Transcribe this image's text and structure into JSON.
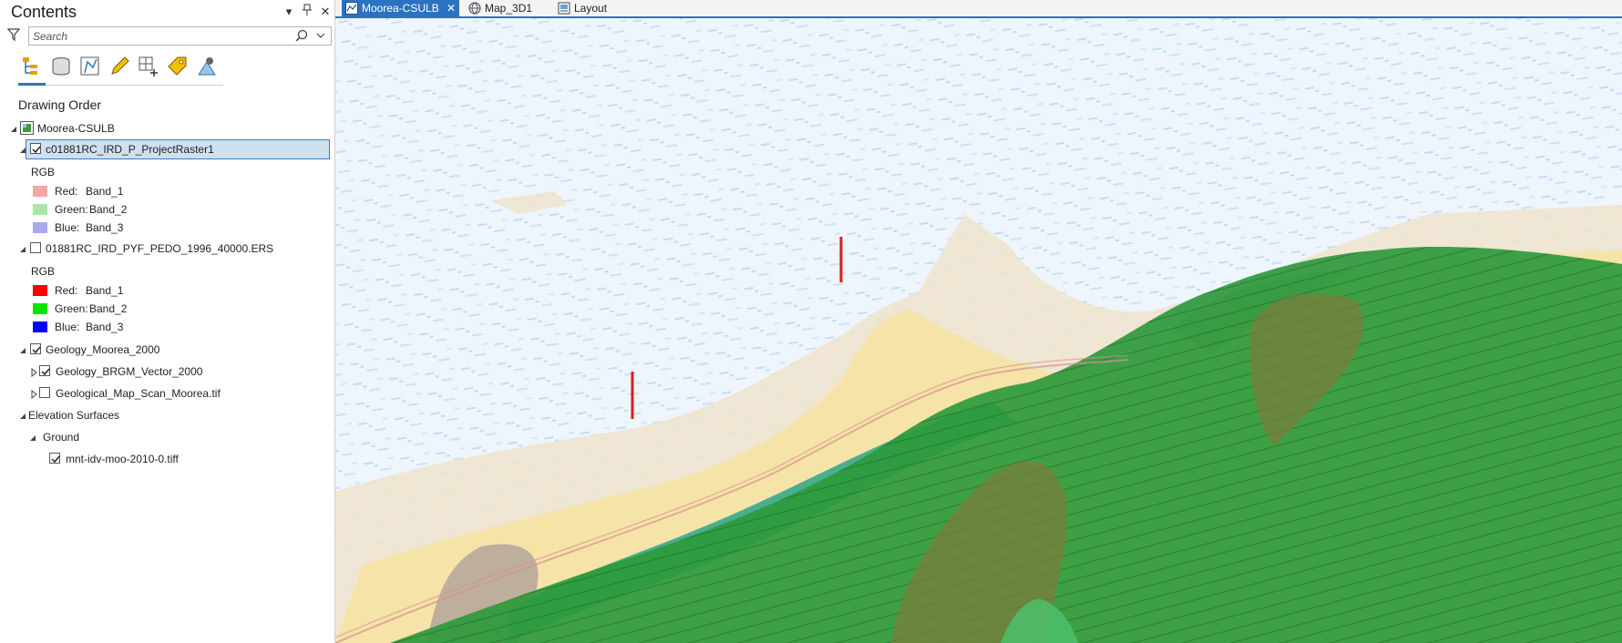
{
  "contents": {
    "title": "Contents",
    "header_buttons": {
      "menu": "▾",
      "pin": "⊿",
      "close": "✕"
    },
    "search": {
      "placeholder": "Search",
      "value": ""
    },
    "section_title": "Drawing Order",
    "map_name": "Moorea-CSULB",
    "layers": [
      {
        "name": "c01881RC_IRD_P_ProjectRaster1",
        "checked": true,
        "selected": true,
        "legend_title": "RGB",
        "bands": [
          {
            "label": "Red:",
            "band": "Band_1",
            "color": "#f4a7a7"
          },
          {
            "label": "Green:",
            "band": "Band_2",
            "color": "#a8e6a8"
          },
          {
            "label": "Blue:",
            "band": "Band_3",
            "color": "#a9a9f0"
          }
        ]
      },
      {
        "name": "01881RC_IRD_PYF_PEDO_1996_40000.ERS",
        "checked": false,
        "selected": false,
        "legend_title": "RGB",
        "bands": [
          {
            "label": "Red:",
            "band": "Band_1",
            "color": "#ff0000"
          },
          {
            "label": "Green:",
            "band": "Band_2",
            "color": "#00e600"
          },
          {
            "label": "Blue:",
            "band": "Band_3",
            "color": "#0000ff"
          }
        ]
      },
      {
        "name": "Geology_Moorea_2000",
        "checked": true,
        "group": true,
        "children": [
          {
            "name": "Geology_BRGM_Vector_2000",
            "checked": true
          },
          {
            "name": "Geological_Map_Scan_Moorea.tif",
            "checked": false
          }
        ]
      }
    ],
    "elevation": {
      "title": "Elevation Surfaces",
      "ground": "Ground",
      "surface": {
        "name": "mnt-idv-moo-2010-0.tiff",
        "checked": true
      }
    }
  },
  "tabs": [
    {
      "label": "Moorea-CSULB",
      "active": true,
      "icon": "map-icon"
    },
    {
      "label": "Map_3D1",
      "active": false,
      "icon": "globe-icon"
    },
    {
      "label": "Layout",
      "active": false,
      "icon": "layout-icon"
    }
  ],
  "map": {
    "colors": {
      "water": "#eef5fc",
      "sand": "#f6e3a8",
      "pale_sand": "#efe4cc",
      "green": "#2e9a3c",
      "dark_green": "#1f7a2d",
      "olive": "#7d7a3a",
      "teal": "#2aa48a",
      "taupe": "#b8a89a",
      "red_marker": "#d42020"
    }
  }
}
